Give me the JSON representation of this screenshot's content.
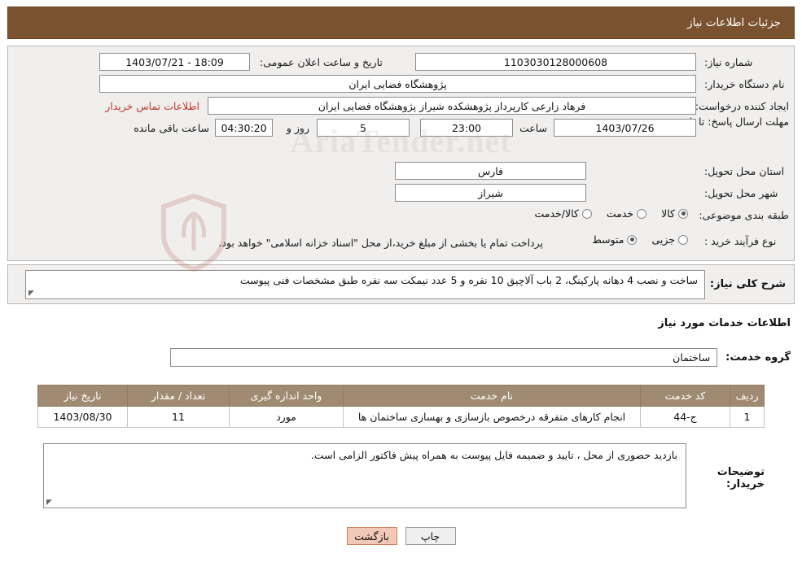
{
  "header": {
    "title": "جزئیات اطلاعات نیاز"
  },
  "form": {
    "need_number_label": "شماره نیاز:",
    "need_number_value": "1103030128000608",
    "announce_datetime_label": "تاریخ و ساعت اعلان عمومی:",
    "announce_datetime_value": "18:09 - 1403/07/21",
    "buyer_org_label": "نام دستگاه خریدار:",
    "buyer_org_value": "پژوهشگاه فضایی ایران",
    "creator_label": "ایجاد کننده درخواست:",
    "creator_value": "فرهاد زارعی کارپرداز پژوهشکده شیراز پژوهشگاه فضایی ایران",
    "buyer_contact_link": "اطلاعات تماس خریدار",
    "deadline_label": "مهلت ارسال پاسخ: تا تاریخ:",
    "deadline_date": "1403/07/26",
    "deadline_hour_label": "ساعت",
    "deadline_hour": "23:00",
    "remaining_days": "5",
    "remaining_days_label": "روز و",
    "remaining_time": "04:30:20",
    "remaining_suffix": "ساعت باقی مانده",
    "province_label": "استان محل تحویل:",
    "province_value": "فارس",
    "city_label": "شهر محل تحویل:",
    "city_value": "شیراز",
    "category_label": "طبقه بندی موضوعی:",
    "category_options": [
      {
        "label": "کالا",
        "selected": true
      },
      {
        "label": "خدمت",
        "selected": false
      },
      {
        "label": "کالا/خدمت",
        "selected": false
      }
    ],
    "process_label": "نوع فرآیند خرید :",
    "process_options": [
      {
        "label": "جزیی",
        "selected": false
      },
      {
        "label": "متوسط",
        "selected": true
      }
    ],
    "process_note": "پرداخت تمام یا بخشی از مبلغ خرید،از محل \"اسناد خزانه اسلامی\" خواهد بود."
  },
  "watermark": {
    "text": "AriaTender.net"
  },
  "description": {
    "label": "شرح کلی نیاز:",
    "value": "ساخت و نصب 4 دهانه پارکینگ، 2 باب آلاچیق 10 نفره و 5 عدد نیمکت سه نفره طبق مشخصات فنی پیوست"
  },
  "services": {
    "section_title": "اطلاعات خدمات مورد نیاز",
    "group_label": "گروه خدمت:",
    "group_value": "ساختمان",
    "table": {
      "headers": [
        "ردیف",
        "کد خدمت",
        "نام خدمت",
        "واحد اندازه گیری",
        "تعداد / مقدار",
        "تاریخ نیاز"
      ],
      "rows": [
        [
          "1",
          "ج-44",
          "انجام کارهای متفرقه درخصوص بازسازی و بهسازی ساختمان ها",
          "مورد",
          "11",
          "1403/08/30"
        ]
      ]
    }
  },
  "notes": {
    "label": "توضیحات خریدار:",
    "value": "بازدید حضوری از محل ، تایید و ضمیمه فایل پیوست به همراه پیش فاکتور الزامی است."
  },
  "footer": {
    "print_label": "چاپ",
    "back_label": "بازگشت"
  }
}
